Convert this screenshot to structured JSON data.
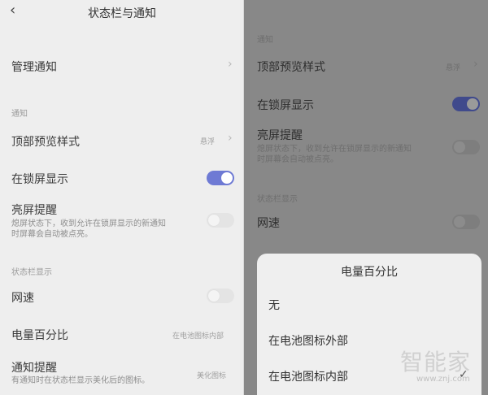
{
  "left": {
    "header": {
      "back_icon": "chevron-left-icon",
      "title": "状态栏与通知"
    },
    "manage_notifications": "管理通知",
    "section_notification": "通知",
    "top_preview": {
      "label": "顶部预览样式",
      "value": "悬浮"
    },
    "lock_screen": {
      "label": "在锁屏显示",
      "on": true
    },
    "wake_screen": {
      "label": "亮屏提醒",
      "desc_line1": "熄屏状态下，收到允许在锁屏显示的新通知",
      "desc_line2": "时屏幕会自动被点亮。",
      "on": false
    },
    "section_statusbar": "状态栏显示",
    "network_speed": {
      "label": "网速",
      "on": false
    },
    "battery_percent": {
      "label": "电量百分比",
      "value": "在电池图标内部"
    },
    "notify_reminder": {
      "label": "通知提醒",
      "desc": "有通知时在状态栏显示美化后的图标。",
      "value": "美化图标"
    }
  },
  "right": {
    "section_notification": "通知",
    "top_preview": {
      "label": "顶部预览样式",
      "value": "悬浮"
    },
    "lock_screen": {
      "label": "在锁屏显示",
      "on": true
    },
    "wake_screen": {
      "label": "亮屏提醒",
      "desc_line1": "熄屏状态下，收到允许在锁屏显示的新通知",
      "desc_line2": "时屏幕会自动被点亮。",
      "on": false
    },
    "section_statusbar": "状态栏显示",
    "network_speed": {
      "label": "网速",
      "on": false
    },
    "sheet": {
      "title": "电量百分比",
      "options": [
        "无",
        "在电池图标外部",
        "在电池图标内部"
      ],
      "selected": "在电池图标内部",
      "check_icon": "checkmark-icon"
    }
  },
  "watermark": {
    "text": "智能家",
    "url": "www.znj.com"
  }
}
